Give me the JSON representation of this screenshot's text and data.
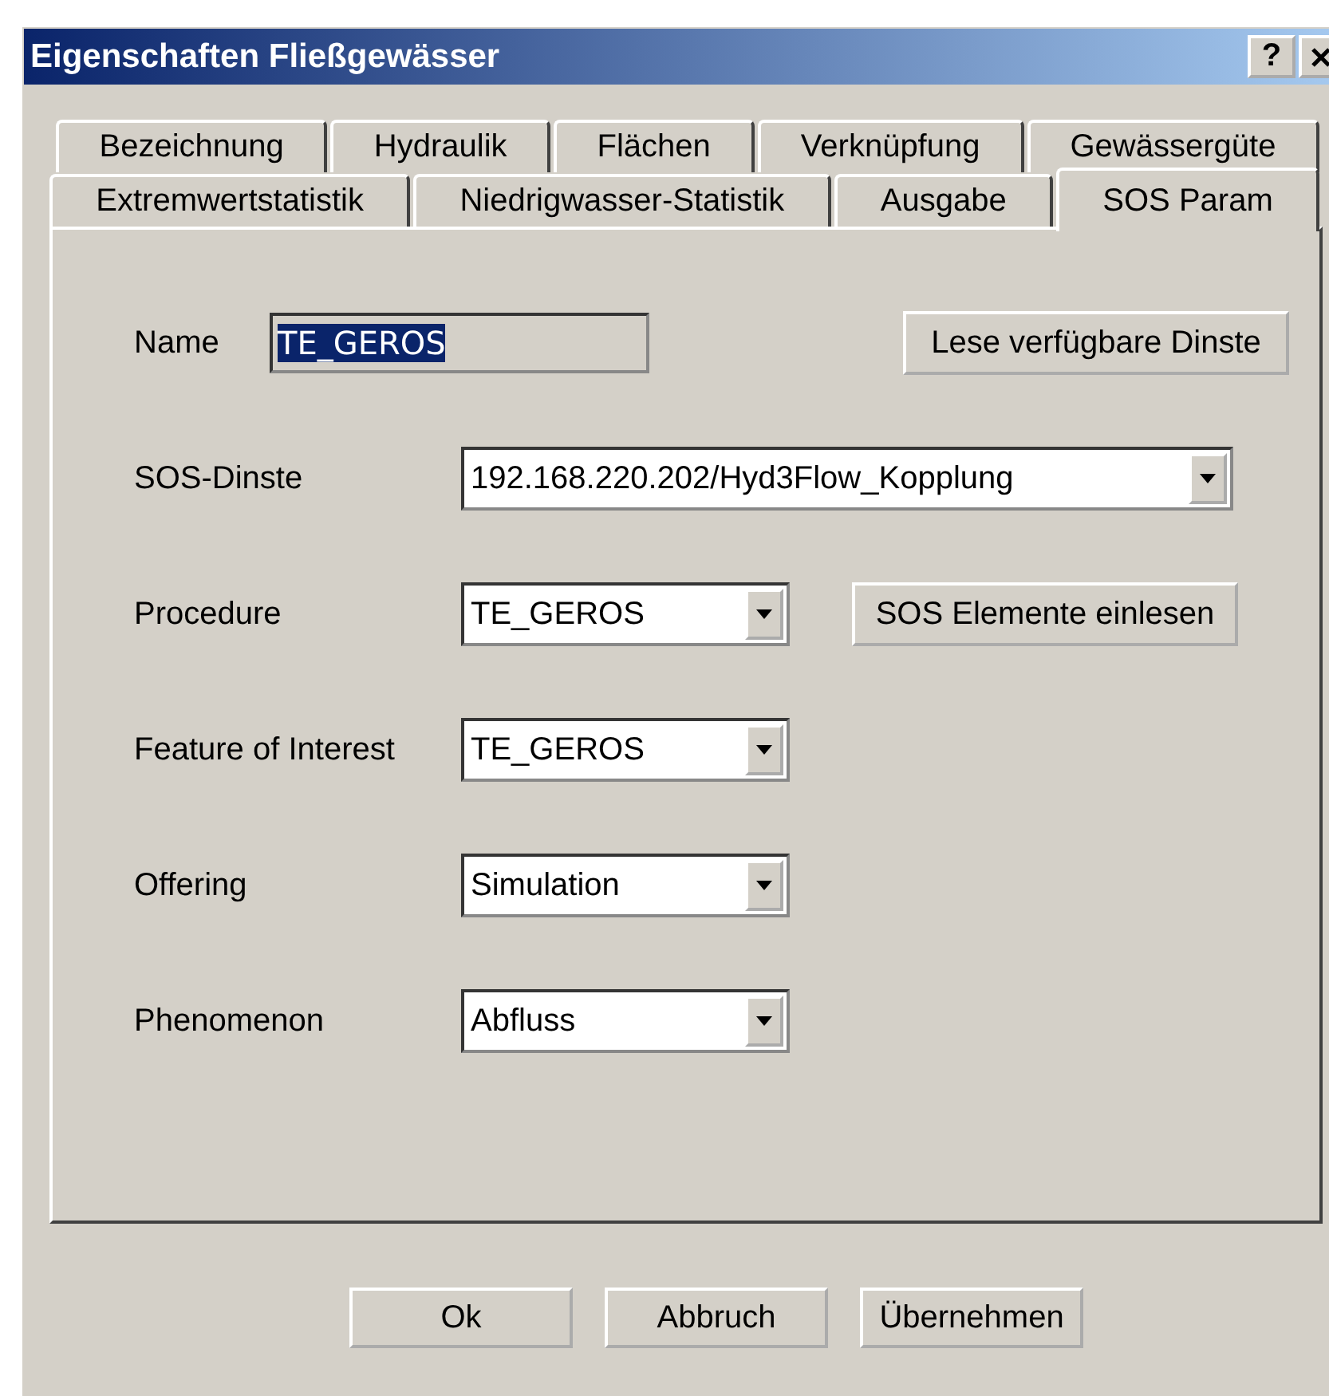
{
  "window": {
    "title": "Eigenschaften Fließgewässer",
    "help_button": "?"
  },
  "tab_rows": [
    {
      "tabs": [
        {
          "label": "Bezeichnung",
          "selected": false
        },
        {
          "label": "Hydraulik",
          "selected": false
        },
        {
          "label": "Flächen",
          "selected": false
        },
        {
          "label": "Verknüpfung",
          "selected": false
        },
        {
          "label": "Gewässergüte",
          "selected": false
        }
      ]
    },
    {
      "tabs": [
        {
          "label": "Extremwertstatistik",
          "selected": false
        },
        {
          "label": "Niedrigwasser-Statistik",
          "selected": false
        },
        {
          "label": "Ausgabe",
          "selected": false
        },
        {
          "label": "SOS Param",
          "selected": true
        }
      ]
    }
  ],
  "name_field": {
    "label": "Name",
    "value": "TE_GEROS",
    "text_selected": true,
    "readonly": true
  },
  "load_button": "Lese verfügbare Dinste",
  "combo_rows": [
    {
      "label": "SOS-Dinste",
      "value": "192.168.220.202/Hyd3Flow_Kopplung",
      "wide": true
    },
    {
      "label": "Procedure",
      "value": "TE_GEROS",
      "wide": false,
      "button": "SOS Elemente einlesen"
    },
    {
      "label": "Feature of Interest",
      "value": "TE_GEROS",
      "wide": false
    },
    {
      "label": "Offering",
      "value": "Simulation",
      "wide": false
    },
    {
      "label": "Phenomenon",
      "value": "Abfluss",
      "wide": false
    }
  ],
  "buttons": [
    "Ok",
    "Abbruch",
    "Übernehmen"
  ]
}
